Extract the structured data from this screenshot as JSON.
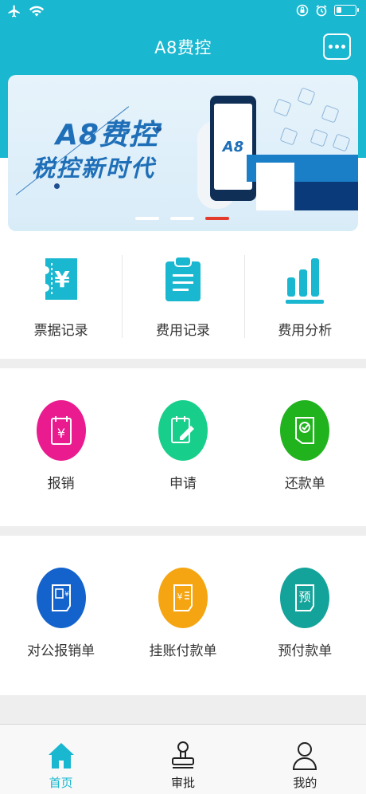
{
  "app": {
    "title": "A8费控"
  },
  "status_bar": {
    "icons": [
      "airplane-icon",
      "wifi-icon",
      "orientation-lock-icon",
      "alarm-icon",
      "battery-icon"
    ]
  },
  "header": {
    "more_button_icon": "more-dots-icon"
  },
  "banner": {
    "headline": "A8费控",
    "subline": "税控新时代",
    "phone_text": "A8",
    "slides": 3,
    "active_slide": 3
  },
  "quick_actions": [
    {
      "label": "票据记录",
      "icon": "receipt-yen-icon"
    },
    {
      "label": "费用记录",
      "icon": "clipboard-list-icon"
    },
    {
      "label": "费用分析",
      "icon": "bar-chart-icon"
    }
  ],
  "forms_row1": [
    {
      "label": "报销",
      "icon": "reimburse-icon",
      "color": "#ea1b8f"
    },
    {
      "label": "申请",
      "icon": "apply-pencil-icon",
      "color": "#17cf8a"
    },
    {
      "label": "还款单",
      "icon": "repay-icon",
      "color": "#21b31e"
    }
  ],
  "forms_row2": [
    {
      "label": "对公报销单",
      "icon": "corporate-reimburse-icon",
      "color": "#1463cc"
    },
    {
      "label": "挂账付款单",
      "icon": "account-payment-icon",
      "color": "#f5a511"
    },
    {
      "label": "预付款单",
      "icon": "prepayment-icon",
      "color": "#13a39a"
    }
  ],
  "bottom_nav": [
    {
      "label": "首页",
      "icon": "home-icon",
      "active": true
    },
    {
      "label": "审批",
      "icon": "stamp-icon",
      "active": false
    },
    {
      "label": "我的",
      "icon": "user-icon",
      "active": false
    }
  ],
  "colors": {
    "brand": "#19b7d0",
    "slide_active": "#e53a2e"
  }
}
